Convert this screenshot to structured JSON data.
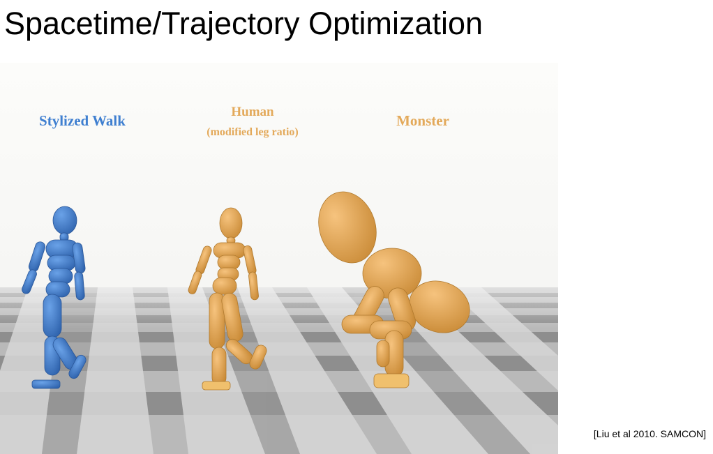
{
  "slide": {
    "title": "Spacetime/Trajectory Optimization",
    "citation": "[Liu et al 2010. SAMCON]"
  },
  "figure": {
    "labels": {
      "stylized_walk": "Stylized Walk",
      "human": "Human",
      "human_note": "(modified leg ratio)",
      "monster": "Monster"
    },
    "colors": {
      "stylized_walk": "#3f7fd0",
      "human": "#e3a95a",
      "monster": "#e3a95a",
      "floor_light": "#d6d6d6",
      "floor_dark": "#8d8d8d"
    }
  }
}
